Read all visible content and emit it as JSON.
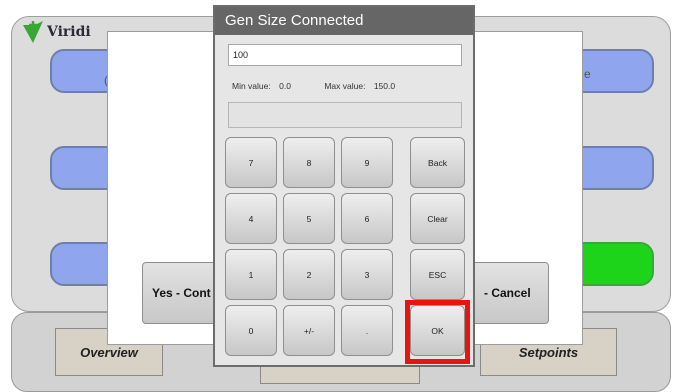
{
  "app": {
    "logo_text": "Viridi",
    "background_fragments": [
      "(",
      "e"
    ],
    "nav": {
      "overview_label": "Overview",
      "setpoints_label": "Setpoints"
    }
  },
  "confirm_dialog": {
    "yes_label": "Yes - Cont",
    "cancel_label": "- Cancel"
  },
  "keypad": {
    "title": "Gen Size Connected",
    "input_value": "100",
    "min_label": "Min value:",
    "min_value": "0.0",
    "max_label": "Max value:",
    "max_value": "150.0",
    "keys": {
      "k7": "7",
      "k8": "8",
      "k9": "9",
      "back": "Back",
      "k4": "4",
      "k5": "5",
      "k6": "6",
      "clear": "Clear",
      "k1": "1",
      "k2": "2",
      "k3": "3",
      "esc": "ESC",
      "k0": "0",
      "sign": "+/-",
      "dot": ".",
      "ok": "OK"
    }
  },
  "colors": {
    "accent_blue": "#8fa6ef",
    "accent_green": "#1ed41b",
    "title_bar": "#666666",
    "highlight_red": "#e8140f"
  }
}
